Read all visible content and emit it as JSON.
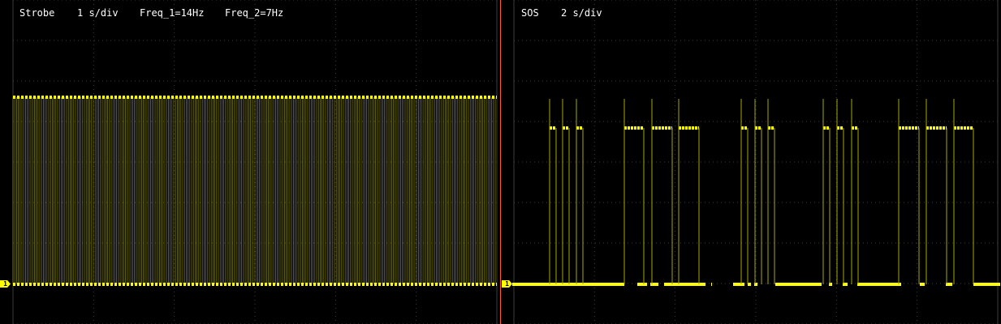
{
  "window": {
    "title": ""
  },
  "colors": {
    "trace": "#ffff00",
    "trace_dim": "#a8a800",
    "grid": "#3d3d3d",
    "divider": "#ff5a2a",
    "text": "#ffffff"
  },
  "left_panel": {
    "mode": "Strobe",
    "timebase": "1 s/div",
    "freq_1": "Freq_1=14Hz",
    "freq_2": "Freq_2=7Hz",
    "channel_marker": "1"
  },
  "right_panel": {
    "mode": "SOS",
    "timebase": "2 s/div",
    "channel_marker": "1"
  }
}
